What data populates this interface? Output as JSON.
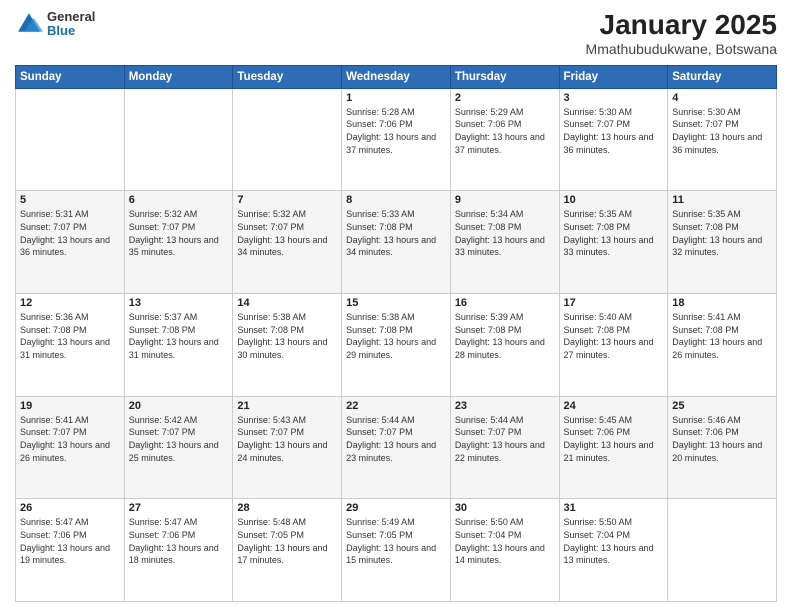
{
  "header": {
    "logo": {
      "general": "General",
      "blue": "Blue"
    },
    "title": "January 2025",
    "subtitle": "Mmathubudukwane, Botswana"
  },
  "days_of_week": [
    "Sunday",
    "Monday",
    "Tuesday",
    "Wednesday",
    "Thursday",
    "Friday",
    "Saturday"
  ],
  "weeks": [
    [
      {
        "day": "",
        "info": ""
      },
      {
        "day": "",
        "info": ""
      },
      {
        "day": "",
        "info": ""
      },
      {
        "day": "1",
        "info": "Sunrise: 5:28 AM\nSunset: 7:06 PM\nDaylight: 13 hours\nand 37 minutes."
      },
      {
        "day": "2",
        "info": "Sunrise: 5:29 AM\nSunset: 7:06 PM\nDaylight: 13 hours\nand 37 minutes."
      },
      {
        "day": "3",
        "info": "Sunrise: 5:30 AM\nSunset: 7:07 PM\nDaylight: 13 hours\nand 36 minutes."
      },
      {
        "day": "4",
        "info": "Sunrise: 5:30 AM\nSunset: 7:07 PM\nDaylight: 13 hours\nand 36 minutes."
      }
    ],
    [
      {
        "day": "5",
        "info": "Sunrise: 5:31 AM\nSunset: 7:07 PM\nDaylight: 13 hours\nand 36 minutes."
      },
      {
        "day": "6",
        "info": "Sunrise: 5:32 AM\nSunset: 7:07 PM\nDaylight: 13 hours\nand 35 minutes."
      },
      {
        "day": "7",
        "info": "Sunrise: 5:32 AM\nSunset: 7:07 PM\nDaylight: 13 hours\nand 34 minutes."
      },
      {
        "day": "8",
        "info": "Sunrise: 5:33 AM\nSunset: 7:08 PM\nDaylight: 13 hours\nand 34 minutes."
      },
      {
        "day": "9",
        "info": "Sunrise: 5:34 AM\nSunset: 7:08 PM\nDaylight: 13 hours\nand 33 minutes."
      },
      {
        "day": "10",
        "info": "Sunrise: 5:35 AM\nSunset: 7:08 PM\nDaylight: 13 hours\nand 33 minutes."
      },
      {
        "day": "11",
        "info": "Sunrise: 5:35 AM\nSunset: 7:08 PM\nDaylight: 13 hours\nand 32 minutes."
      }
    ],
    [
      {
        "day": "12",
        "info": "Sunrise: 5:36 AM\nSunset: 7:08 PM\nDaylight: 13 hours\nand 31 minutes."
      },
      {
        "day": "13",
        "info": "Sunrise: 5:37 AM\nSunset: 7:08 PM\nDaylight: 13 hours\nand 31 minutes."
      },
      {
        "day": "14",
        "info": "Sunrise: 5:38 AM\nSunset: 7:08 PM\nDaylight: 13 hours\nand 30 minutes."
      },
      {
        "day": "15",
        "info": "Sunrise: 5:38 AM\nSunset: 7:08 PM\nDaylight: 13 hours\nand 29 minutes."
      },
      {
        "day": "16",
        "info": "Sunrise: 5:39 AM\nSunset: 7:08 PM\nDaylight: 13 hours\nand 28 minutes."
      },
      {
        "day": "17",
        "info": "Sunrise: 5:40 AM\nSunset: 7:08 PM\nDaylight: 13 hours\nand 27 minutes."
      },
      {
        "day": "18",
        "info": "Sunrise: 5:41 AM\nSunset: 7:08 PM\nDaylight: 13 hours\nand 26 minutes."
      }
    ],
    [
      {
        "day": "19",
        "info": "Sunrise: 5:41 AM\nSunset: 7:07 PM\nDaylight: 13 hours\nand 26 minutes."
      },
      {
        "day": "20",
        "info": "Sunrise: 5:42 AM\nSunset: 7:07 PM\nDaylight: 13 hours\nand 25 minutes."
      },
      {
        "day": "21",
        "info": "Sunrise: 5:43 AM\nSunset: 7:07 PM\nDaylight: 13 hours\nand 24 minutes."
      },
      {
        "day": "22",
        "info": "Sunrise: 5:44 AM\nSunset: 7:07 PM\nDaylight: 13 hours\nand 23 minutes."
      },
      {
        "day": "23",
        "info": "Sunrise: 5:44 AM\nSunset: 7:07 PM\nDaylight: 13 hours\nand 22 minutes."
      },
      {
        "day": "24",
        "info": "Sunrise: 5:45 AM\nSunset: 7:06 PM\nDaylight: 13 hours\nand 21 minutes."
      },
      {
        "day": "25",
        "info": "Sunrise: 5:46 AM\nSunset: 7:06 PM\nDaylight: 13 hours\nand 20 minutes."
      }
    ],
    [
      {
        "day": "26",
        "info": "Sunrise: 5:47 AM\nSunset: 7:06 PM\nDaylight: 13 hours\nand 19 minutes."
      },
      {
        "day": "27",
        "info": "Sunrise: 5:47 AM\nSunset: 7:06 PM\nDaylight: 13 hours\nand 18 minutes."
      },
      {
        "day": "28",
        "info": "Sunrise: 5:48 AM\nSunset: 7:05 PM\nDaylight: 13 hours\nand 17 minutes."
      },
      {
        "day": "29",
        "info": "Sunrise: 5:49 AM\nSunset: 7:05 PM\nDaylight: 13 hours\nand 15 minutes."
      },
      {
        "day": "30",
        "info": "Sunrise: 5:50 AM\nSunset: 7:04 PM\nDaylight: 13 hours\nand 14 minutes."
      },
      {
        "day": "31",
        "info": "Sunrise: 5:50 AM\nSunset: 7:04 PM\nDaylight: 13 hours\nand 13 minutes."
      },
      {
        "day": "",
        "info": ""
      }
    ]
  ]
}
